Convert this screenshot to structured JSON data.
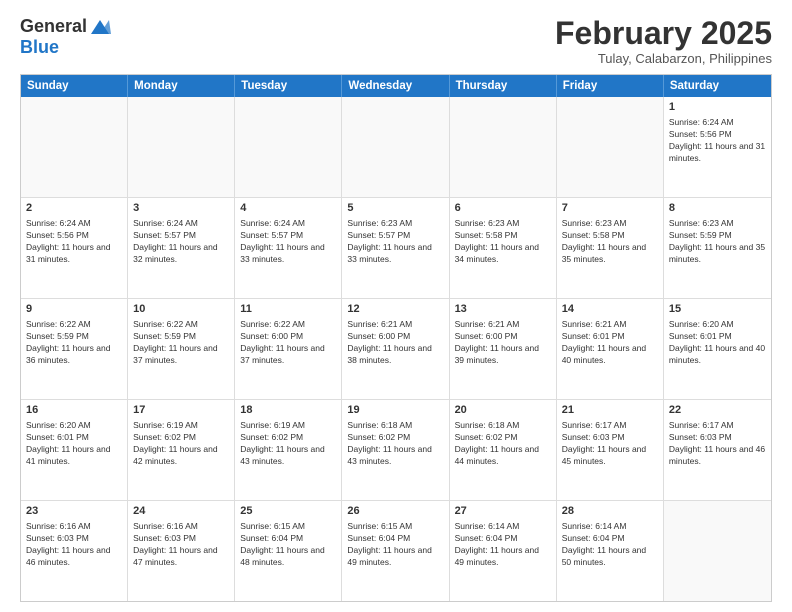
{
  "header": {
    "logo_general": "General",
    "logo_blue": "Blue",
    "month_title": "February 2025",
    "location": "Tulay, Calabarzon, Philippines"
  },
  "days_of_week": [
    "Sunday",
    "Monday",
    "Tuesday",
    "Wednesday",
    "Thursday",
    "Friday",
    "Saturday"
  ],
  "weeks": [
    [
      {
        "day": "",
        "text": ""
      },
      {
        "day": "",
        "text": ""
      },
      {
        "day": "",
        "text": ""
      },
      {
        "day": "",
        "text": ""
      },
      {
        "day": "",
        "text": ""
      },
      {
        "day": "",
        "text": ""
      },
      {
        "day": "1",
        "text": "Sunrise: 6:24 AM\nSunset: 5:56 PM\nDaylight: 11 hours and 31 minutes."
      }
    ],
    [
      {
        "day": "2",
        "text": "Sunrise: 6:24 AM\nSunset: 5:56 PM\nDaylight: 11 hours and 31 minutes."
      },
      {
        "day": "3",
        "text": "Sunrise: 6:24 AM\nSunset: 5:57 PM\nDaylight: 11 hours and 32 minutes."
      },
      {
        "day": "4",
        "text": "Sunrise: 6:24 AM\nSunset: 5:57 PM\nDaylight: 11 hours and 33 minutes."
      },
      {
        "day": "5",
        "text": "Sunrise: 6:23 AM\nSunset: 5:57 PM\nDaylight: 11 hours and 33 minutes."
      },
      {
        "day": "6",
        "text": "Sunrise: 6:23 AM\nSunset: 5:58 PM\nDaylight: 11 hours and 34 minutes."
      },
      {
        "day": "7",
        "text": "Sunrise: 6:23 AM\nSunset: 5:58 PM\nDaylight: 11 hours and 35 minutes."
      },
      {
        "day": "8",
        "text": "Sunrise: 6:23 AM\nSunset: 5:59 PM\nDaylight: 11 hours and 35 minutes."
      }
    ],
    [
      {
        "day": "9",
        "text": "Sunrise: 6:22 AM\nSunset: 5:59 PM\nDaylight: 11 hours and 36 minutes."
      },
      {
        "day": "10",
        "text": "Sunrise: 6:22 AM\nSunset: 5:59 PM\nDaylight: 11 hours and 37 minutes."
      },
      {
        "day": "11",
        "text": "Sunrise: 6:22 AM\nSunset: 6:00 PM\nDaylight: 11 hours and 37 minutes."
      },
      {
        "day": "12",
        "text": "Sunrise: 6:21 AM\nSunset: 6:00 PM\nDaylight: 11 hours and 38 minutes."
      },
      {
        "day": "13",
        "text": "Sunrise: 6:21 AM\nSunset: 6:00 PM\nDaylight: 11 hours and 39 minutes."
      },
      {
        "day": "14",
        "text": "Sunrise: 6:21 AM\nSunset: 6:01 PM\nDaylight: 11 hours and 40 minutes."
      },
      {
        "day": "15",
        "text": "Sunrise: 6:20 AM\nSunset: 6:01 PM\nDaylight: 11 hours and 40 minutes."
      }
    ],
    [
      {
        "day": "16",
        "text": "Sunrise: 6:20 AM\nSunset: 6:01 PM\nDaylight: 11 hours and 41 minutes."
      },
      {
        "day": "17",
        "text": "Sunrise: 6:19 AM\nSunset: 6:02 PM\nDaylight: 11 hours and 42 minutes."
      },
      {
        "day": "18",
        "text": "Sunrise: 6:19 AM\nSunset: 6:02 PM\nDaylight: 11 hours and 43 minutes."
      },
      {
        "day": "19",
        "text": "Sunrise: 6:18 AM\nSunset: 6:02 PM\nDaylight: 11 hours and 43 minutes."
      },
      {
        "day": "20",
        "text": "Sunrise: 6:18 AM\nSunset: 6:02 PM\nDaylight: 11 hours and 44 minutes."
      },
      {
        "day": "21",
        "text": "Sunrise: 6:17 AM\nSunset: 6:03 PM\nDaylight: 11 hours and 45 minutes."
      },
      {
        "day": "22",
        "text": "Sunrise: 6:17 AM\nSunset: 6:03 PM\nDaylight: 11 hours and 46 minutes."
      }
    ],
    [
      {
        "day": "23",
        "text": "Sunrise: 6:16 AM\nSunset: 6:03 PM\nDaylight: 11 hours and 46 minutes."
      },
      {
        "day": "24",
        "text": "Sunrise: 6:16 AM\nSunset: 6:03 PM\nDaylight: 11 hours and 47 minutes."
      },
      {
        "day": "25",
        "text": "Sunrise: 6:15 AM\nSunset: 6:04 PM\nDaylight: 11 hours and 48 minutes."
      },
      {
        "day": "26",
        "text": "Sunrise: 6:15 AM\nSunset: 6:04 PM\nDaylight: 11 hours and 49 minutes."
      },
      {
        "day": "27",
        "text": "Sunrise: 6:14 AM\nSunset: 6:04 PM\nDaylight: 11 hours and 49 minutes."
      },
      {
        "day": "28",
        "text": "Sunrise: 6:14 AM\nSunset: 6:04 PM\nDaylight: 11 hours and 50 minutes."
      },
      {
        "day": "",
        "text": ""
      }
    ]
  ]
}
